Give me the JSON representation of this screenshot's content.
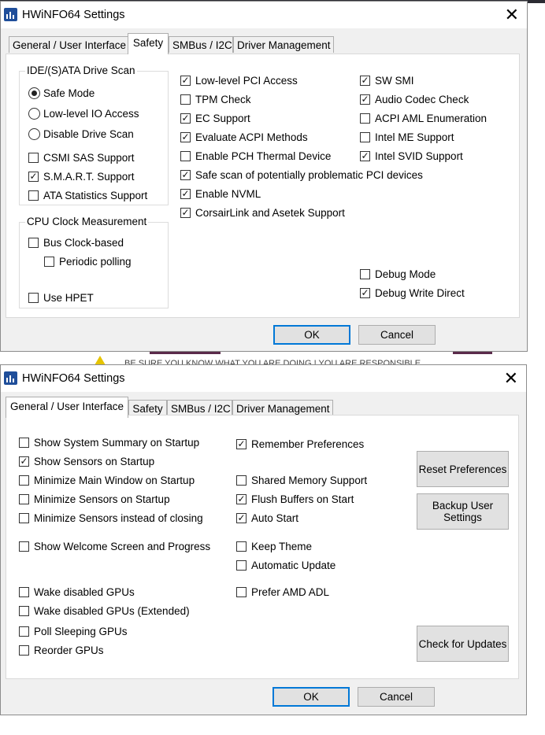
{
  "bg": {
    "top_text": "",
    "warning_text": "BE SURE YOU KNOW WHAT YOU ARE DOING ! YOU ARE RESPONSIBLE"
  },
  "window1": {
    "title": "HWiNFO64 Settings",
    "close_glyph": "✕",
    "tabs": [
      "General / User Interface",
      "Safety",
      "SMBus / I2C",
      "Driver Management"
    ],
    "active_tab": "Safety",
    "drive_group": {
      "label": "IDE/(S)ATA Drive Scan",
      "radios": [
        {
          "label": "Safe Mode",
          "selected": true
        },
        {
          "label": "Low-level IO Access",
          "selected": false
        },
        {
          "label": "Disable Drive Scan",
          "selected": false
        }
      ],
      "checks": [
        {
          "label": "CSMI SAS Support",
          "checked": false
        },
        {
          "label": "S.M.A.R.T. Support",
          "checked": true
        },
        {
          "label": "ATA Statistics Support",
          "checked": false
        }
      ]
    },
    "cpu_group": {
      "label": "CPU Clock Measurement",
      "bus_clock": {
        "label": "Bus Clock-based",
        "checked": false
      },
      "periodic": {
        "label": "Periodic polling",
        "checked": false
      },
      "hpet": {
        "label": "Use HPET",
        "checked": false
      }
    },
    "middle": [
      {
        "label": "Low-level PCI Access",
        "checked": true
      },
      {
        "label": "TPM Check",
        "checked": false
      },
      {
        "label": "EC Support",
        "checked": true
      },
      {
        "label": "Evaluate ACPI Methods",
        "checked": true
      },
      {
        "label": "Enable PCH Thermal Device",
        "checked": false
      },
      {
        "label": "Safe scan of potentially problematic PCI devices",
        "checked": true
      },
      {
        "label": "Enable NVML",
        "checked": true
      },
      {
        "label": "CorsairLink and Asetek Support",
        "checked": true
      }
    ],
    "right": [
      {
        "label": "SW SMI",
        "checked": true
      },
      {
        "label": "Audio Codec Check",
        "checked": true
      },
      {
        "label": "ACPI AML Enumeration",
        "checked": false
      },
      {
        "label": "Intel ME Support",
        "checked": false
      },
      {
        "label": "Intel SVID Support",
        "checked": true
      }
    ],
    "debug_mode": {
      "label": "Debug Mode",
      "checked": false
    },
    "debug_write": {
      "label": "Debug Write Direct",
      "checked": true
    },
    "ok": "OK",
    "cancel": "Cancel"
  },
  "window2": {
    "title": "HWiNFO64 Settings",
    "close_glyph": "✕",
    "tabs": [
      "General / User Interface",
      "Safety",
      "SMBus / I2C",
      "Driver Management"
    ],
    "active_tab": "General / User Interface",
    "left": [
      {
        "label": "Show System Summary on Startup",
        "checked": false
      },
      {
        "label": "Show Sensors on Startup",
        "checked": true
      },
      {
        "label": "Minimize Main Window on Startup",
        "checked": false
      },
      {
        "label": "Minimize Sensors on Startup",
        "checked": false
      },
      {
        "label": "Minimize Sensors instead of closing",
        "checked": false
      },
      {
        "label": "Show Welcome Screen and Progress",
        "checked": false
      },
      {
        "label": "Wake disabled GPUs",
        "checked": false
      },
      {
        "label": "Wake disabled GPUs (Extended)",
        "checked": false
      },
      {
        "label": "Poll Sleeping GPUs",
        "checked": false
      },
      {
        "label": "Reorder GPUs",
        "checked": false
      }
    ],
    "middle": [
      {
        "label": "Remember Preferences",
        "checked": true
      },
      {
        "label": "Shared Memory Support",
        "checked": false
      },
      {
        "label": "Flush Buffers on Start",
        "checked": true
      },
      {
        "label": "Auto Start",
        "checked": true
      },
      {
        "label": "Keep Theme",
        "checked": false
      },
      {
        "label": "Automatic Update",
        "checked": false
      },
      {
        "label": "Prefer AMD ADL",
        "checked": false
      }
    ],
    "reset_btn": "Reset Preferences",
    "backup_btn_line1": "Backup User",
    "backup_btn_line2": "Settings",
    "check_updates_btn": "Check for Updates",
    "ok": "OK",
    "cancel": "Cancel"
  },
  "colors": {
    "accent": "#0078d7",
    "window_bg": "#f0f0f0",
    "app_icon": "#1f4e9a"
  }
}
